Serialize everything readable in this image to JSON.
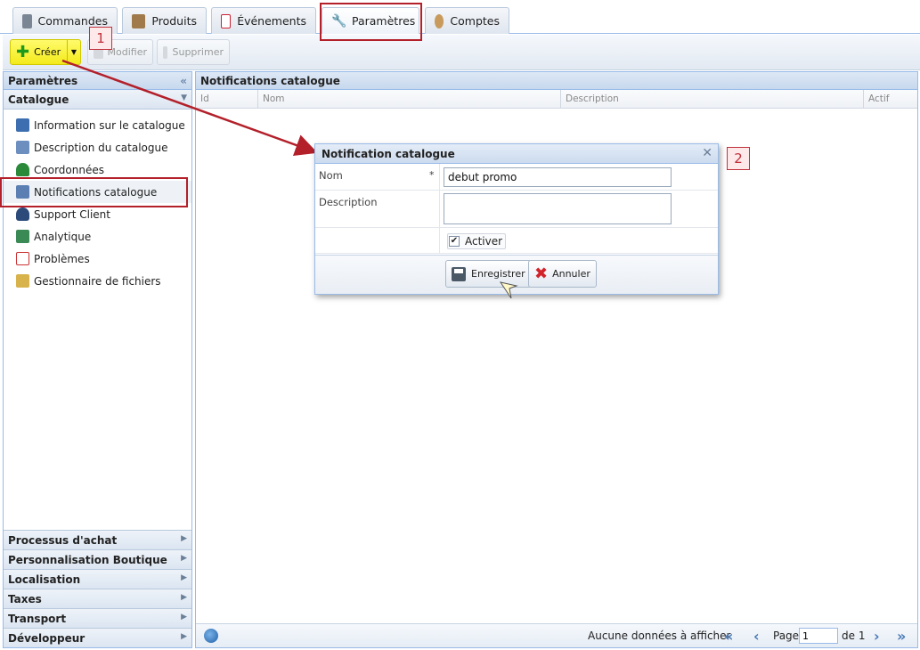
{
  "tabs": [
    {
      "label": "Commandes",
      "icon": "printer-icon"
    },
    {
      "label": "Produits",
      "icon": "box-icon"
    },
    {
      "label": "Événements",
      "icon": "calendar-icon"
    },
    {
      "label": "Paramètres",
      "icon": "wrench-icon"
    },
    {
      "label": "Comptes",
      "icon": "users-icon"
    }
  ],
  "toolbar": {
    "create_label": "Créer",
    "modify_label": "Modifier",
    "delete_label": "Supprimer"
  },
  "left_panel": {
    "title": "Paramètres",
    "section_open": "Catalogue",
    "items": [
      {
        "label": "Information sur le catalogue",
        "icon": "catalog-info-icon"
      },
      {
        "label": "Description du catalogue",
        "icon": "catalog-edit-icon"
      },
      {
        "label": "Coordonnées",
        "icon": "signpost-icon"
      },
      {
        "label": "Notifications catalogue",
        "icon": "notification-icon"
      },
      {
        "label": "Support Client",
        "icon": "support-user-icon"
      },
      {
        "label": "Analytique",
        "icon": "analytics-icon"
      },
      {
        "label": "Problèmes",
        "icon": "problem-icon"
      },
      {
        "label": "Gestionnaire de fichiers",
        "icon": "file-manager-icon"
      }
    ],
    "sections_collapsed": [
      "Processus d'achat",
      "Personnalisation Boutique",
      "Localisation",
      "Taxes",
      "Transport",
      "Développeur"
    ]
  },
  "grid": {
    "title": "Notifications catalogue",
    "columns": [
      "Id",
      "Nom",
      "Description",
      "Actif"
    ],
    "rows": []
  },
  "pager": {
    "no_data": "Aucune données à afficher",
    "page_label": "Page",
    "page_value": "1",
    "of_label": "de 1"
  },
  "dialog": {
    "title": "Notification catalogue",
    "close_symbol": "✕",
    "name_label": "Nom",
    "required_marker": "*",
    "name_value": "debut promo",
    "description_label": "Description",
    "description_value": "",
    "activate_label": "Activer",
    "activate_checked": true,
    "save_label": "Enregistrer",
    "cancel_label": "Annuler"
  },
  "annotations": {
    "step1": "1",
    "step2": "2"
  },
  "colors": {
    "accent_border": "#99bbe8",
    "annotation_red": "#b3202a",
    "create_button": "#f3ea1b"
  }
}
